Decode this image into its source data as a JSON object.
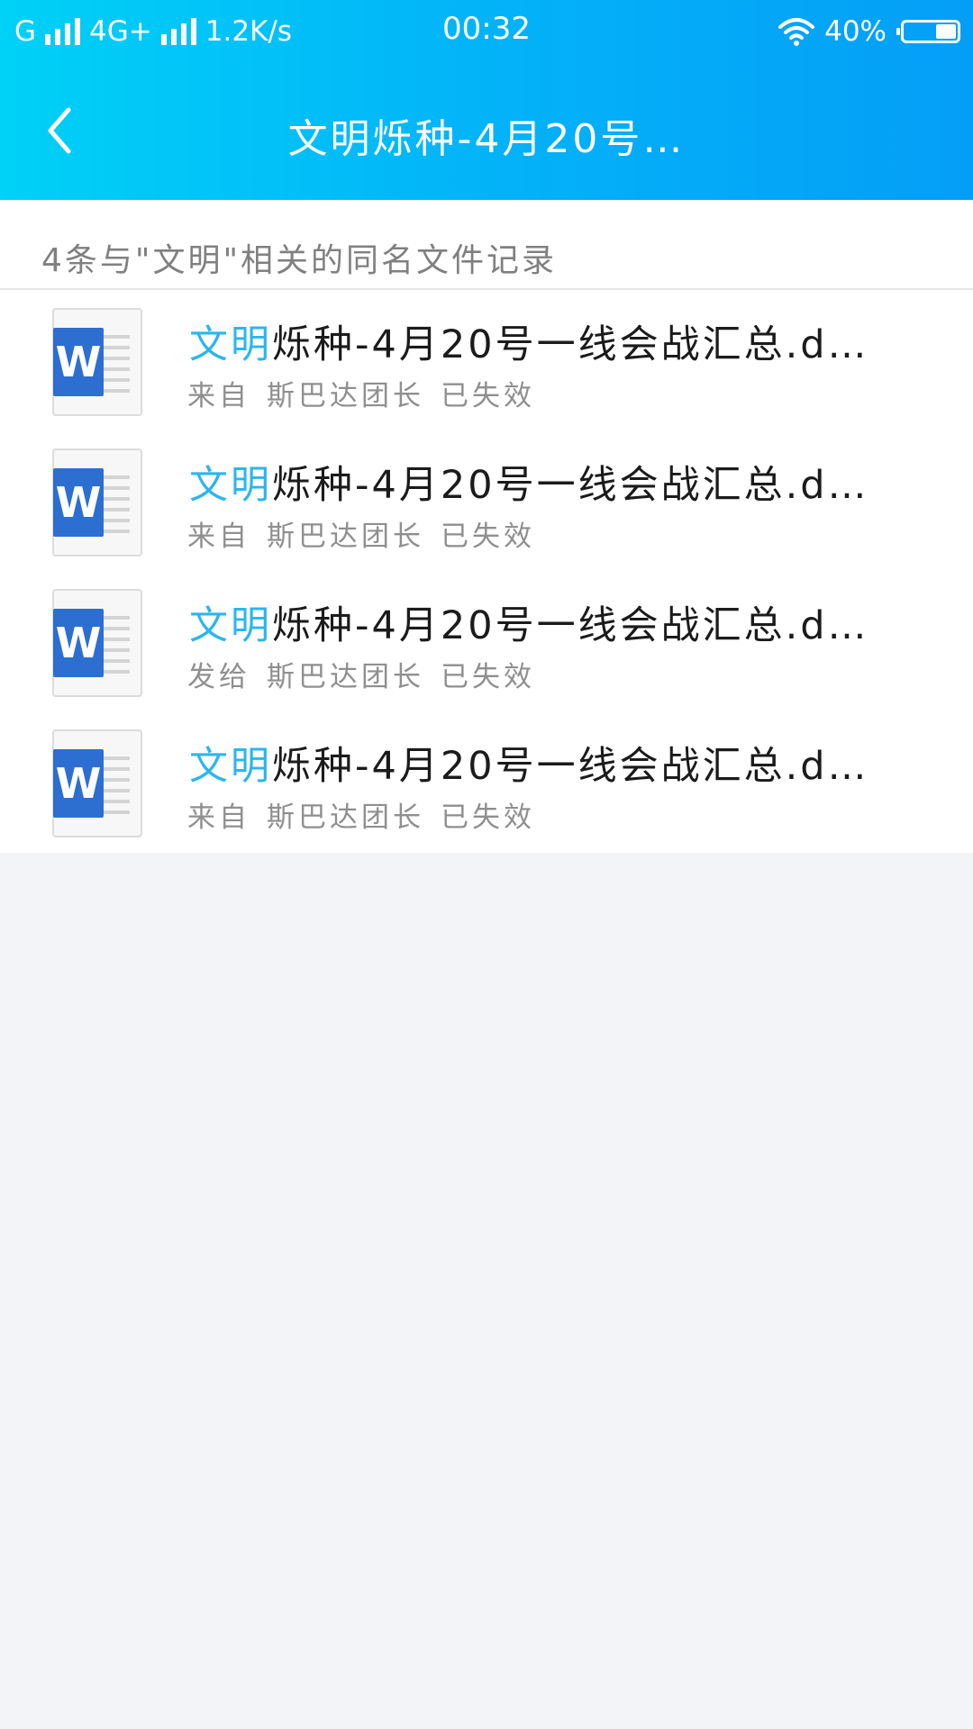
{
  "status_bar": {
    "carrier1": "G",
    "carrier2": "4G+",
    "speed": "1.2K/s",
    "time": "00:32",
    "battery_text": "40%",
    "battery_level": 0.4
  },
  "navbar": {
    "title": "文明烁种-4月20号…"
  },
  "summary": {
    "text": "4条与\"文明\"相关的同名文件记录"
  },
  "files": [
    {
      "name_highlight": "文明",
      "name_rest": "烁种-4月20号一线会战汇总.d…",
      "direction": "来自",
      "sender": "斯巴达团长",
      "status": "已失效"
    },
    {
      "name_highlight": "文明",
      "name_rest": "烁种-4月20号一线会战汇总.d…",
      "direction": "来自",
      "sender": "斯巴达团长",
      "status": "已失效"
    },
    {
      "name_highlight": "文明",
      "name_rest": "烁种-4月20号一线会战汇总.d…",
      "direction": "发给",
      "sender": "斯巴达团长",
      "status": "已失效"
    },
    {
      "name_highlight": "文明",
      "name_rest": "烁种-4月20号一线会战汇总.d…",
      "direction": "来自",
      "sender": "斯巴达团长",
      "status": "已失效"
    }
  ],
  "icons": {
    "back": "chevron-left-icon",
    "file": "word-document-icon",
    "wifi": "wifi-icon",
    "signal": "signal-bars-icon",
    "battery": "battery-icon"
  },
  "colors": {
    "header_gradient_start": "#00d1f7",
    "header_gradient_end": "#059ef7",
    "highlight": "#2bb6ec",
    "word_blue": "#2d6fd1",
    "meta_text": "#8f8f8f",
    "page_bg": "#f3f4f8"
  }
}
